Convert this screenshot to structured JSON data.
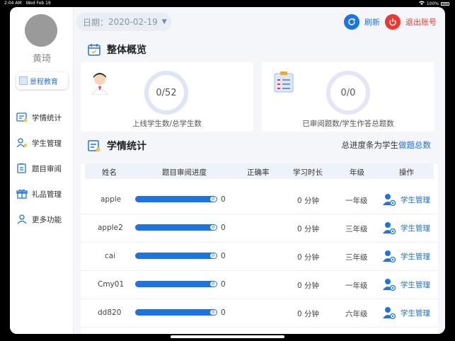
{
  "status_bar": {
    "time": "2:04 AM",
    "date": "Wed Feb 19",
    "battery": "100%"
  },
  "sidebar": {
    "user_name": "黄琦",
    "org_name": "景程教育",
    "items": [
      {
        "label": "学情统计",
        "icon": "stats-icon"
      },
      {
        "label": "学生管理",
        "icon": "student-icon"
      },
      {
        "label": "题目审阅",
        "icon": "review-icon"
      },
      {
        "label": "礼品管理",
        "icon": "gift-icon"
      },
      {
        "label": "更多功能",
        "icon": "more-icon"
      }
    ]
  },
  "topbar": {
    "date_label": "日期：",
    "date_value": "2020-02-19",
    "refresh_label": "刷新",
    "logout_label": "退出账号",
    "colors": {
      "accent": "#1a73e8",
      "danger": "#f0372f"
    }
  },
  "overview": {
    "title": "整体概览",
    "cards": [
      {
        "value": "0/52",
        "label": "上线学生数/总学生数"
      },
      {
        "value": "0/0",
        "label": "已审阅题数/学生作答总题数"
      }
    ]
  },
  "stats": {
    "title": "学情统计",
    "note_prefix": "总进度条为学生",
    "note_highlight": "做题总数",
    "columns": [
      "姓名",
      "题目审阅进度",
      "正确率",
      "学习时长",
      "年级",
      "操作"
    ],
    "rows": [
      {
        "name": "apple",
        "progress_knob": "0",
        "progress_text": "0",
        "accuracy": "",
        "duration": "0 分钟",
        "grade": "一年级",
        "action": "学生管理",
        "progress": 0
      },
      {
        "name": "apple2",
        "progress_knob": "0",
        "progress_text": "0",
        "accuracy": "",
        "duration": "0 分钟",
        "grade": "三年级",
        "action": "学生管理",
        "progress": 0
      },
      {
        "name": "cai",
        "progress_knob": "0",
        "progress_text": "0",
        "accuracy": "",
        "duration": "0 分钟",
        "grade": "三年级",
        "action": "学生管理",
        "progress": 0
      },
      {
        "name": "Cmy01",
        "progress_knob": "0",
        "progress_text": "0",
        "accuracy": "",
        "duration": "0 分钟",
        "grade": "一年级",
        "action": "学生管理",
        "progress": 0
      },
      {
        "name": "dd820",
        "progress_knob": "0",
        "progress_text": "0",
        "accuracy": "",
        "duration": "0 分钟",
        "grade": "六年级",
        "action": "学生管理",
        "progress": 0
      }
    ]
  }
}
